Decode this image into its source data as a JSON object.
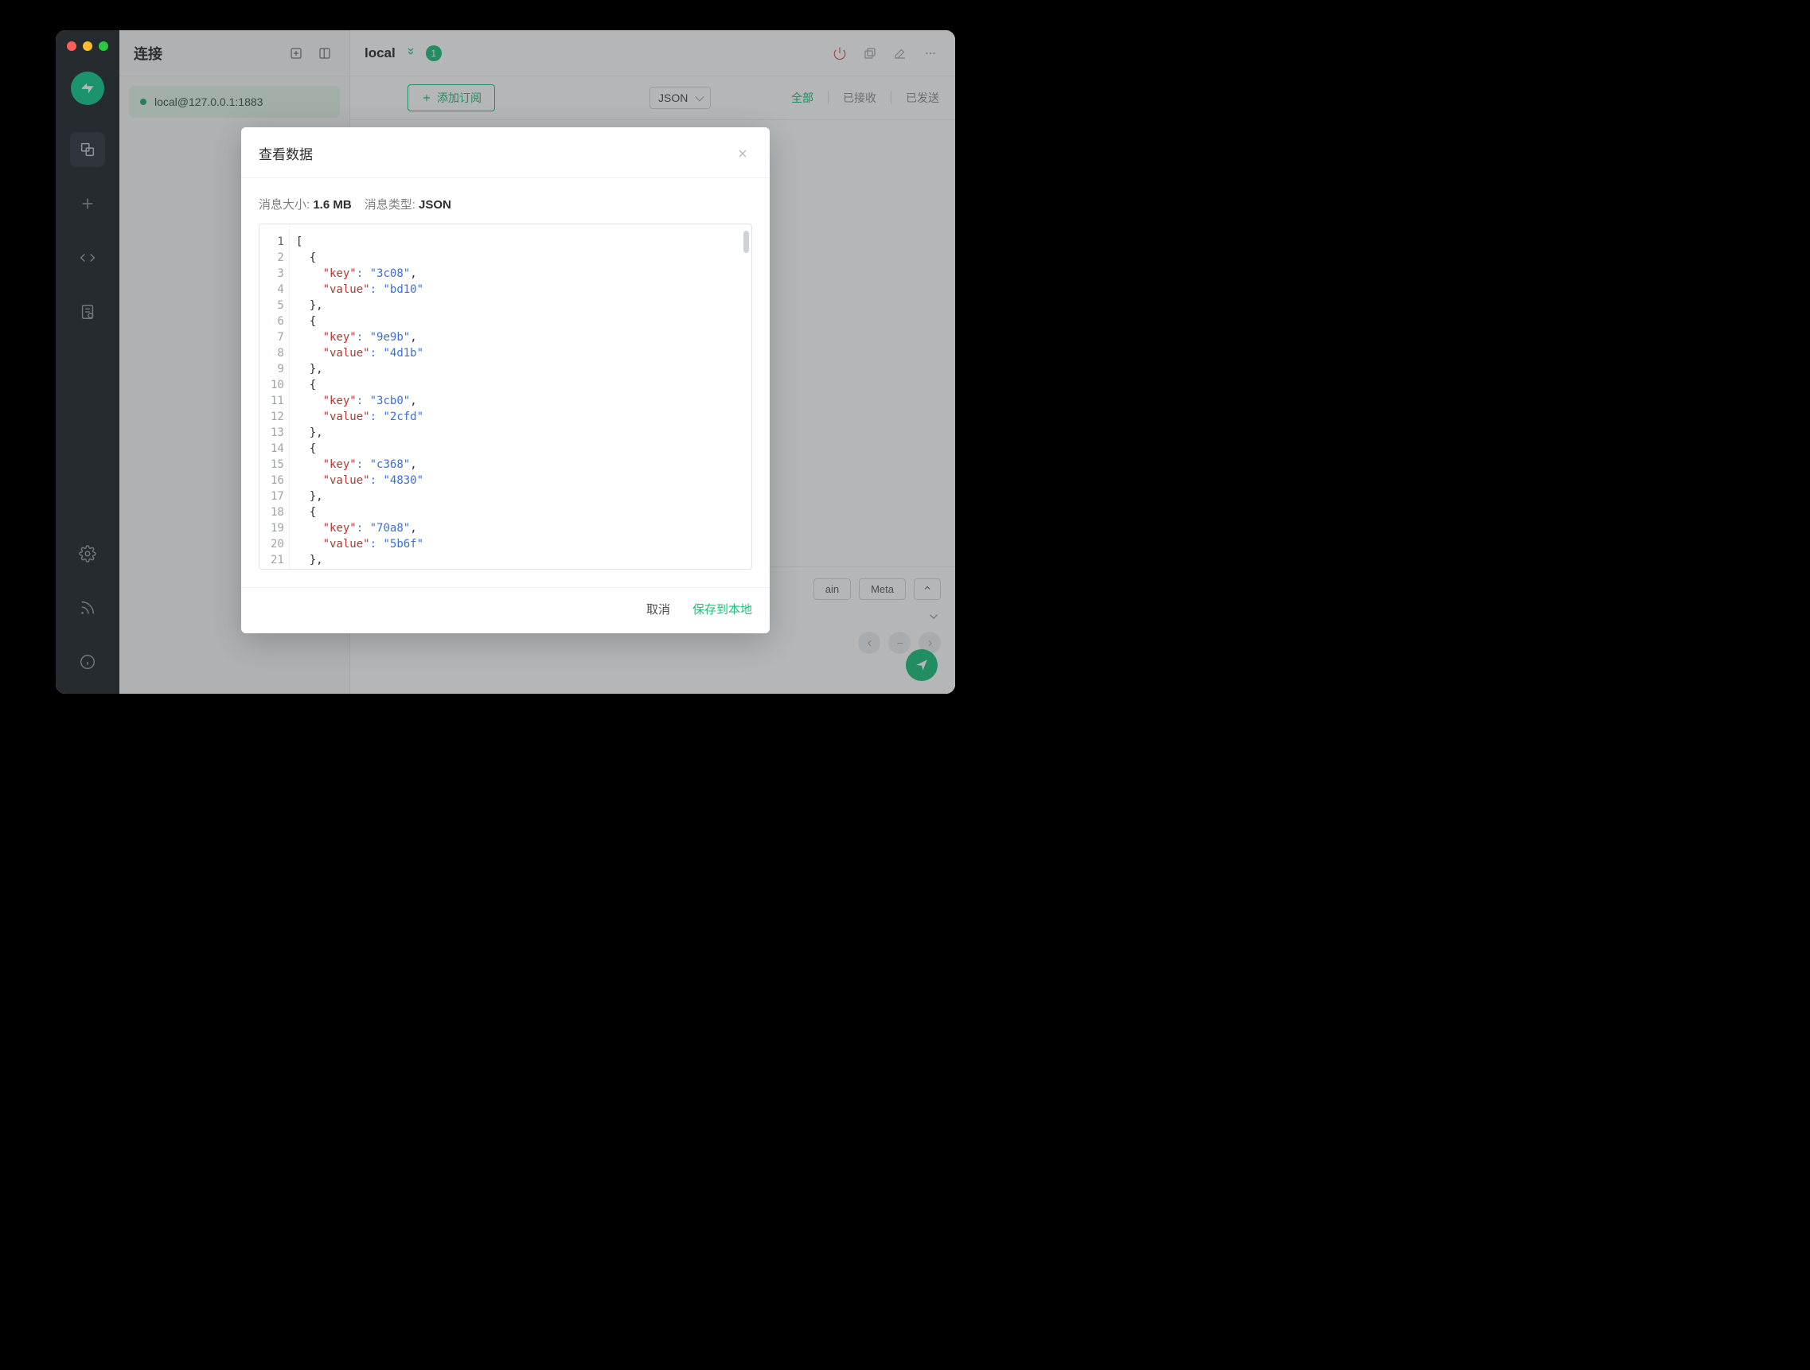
{
  "sidebar": {},
  "conn_panel": {
    "title": "连接",
    "items": [
      {
        "name": "local@127.0.0.1:1883"
      }
    ]
  },
  "main_header": {
    "name": "local",
    "badge": "1"
  },
  "filter_bar": {
    "add_sub_label": "添加订阅",
    "format_select": "JSON",
    "tabs": {
      "all": "全部",
      "received": "已接收",
      "sent": "已发送"
    }
  },
  "compose": {
    "retain_label": "ain",
    "meta_label": "Meta"
  },
  "modal": {
    "title": "查看数据",
    "size_label": "消息大小:",
    "size_value": "1.6 MB",
    "type_label": "消息类型:",
    "type_value": "JSON",
    "cancel": "取消",
    "save": "保存到本地",
    "code_entries": [
      {
        "key": "3c08",
        "value": "bd10"
      },
      {
        "key": "9e9b",
        "value": "4d1b"
      },
      {
        "key": "3cb0",
        "value": "2cfd"
      },
      {
        "key": "c368",
        "value": "4830"
      },
      {
        "key": "70a8",
        "value": "5b6f"
      }
    ]
  }
}
